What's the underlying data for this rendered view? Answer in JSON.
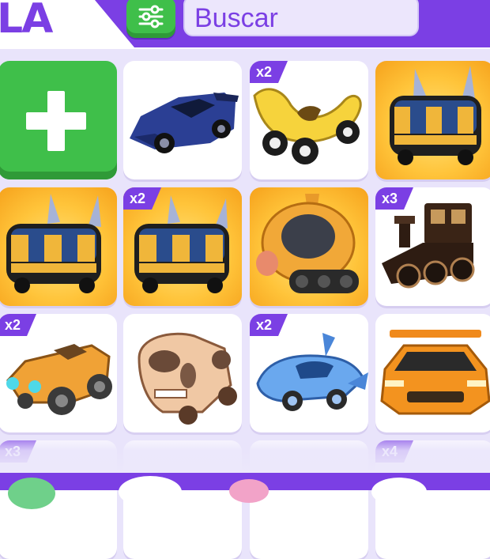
{
  "header": {
    "title_fragment": "LA",
    "search": {
      "placeholder": "Buscar"
    }
  },
  "icons": {
    "filter": "sliders-icon",
    "add": "plus-icon"
  },
  "colors": {
    "accent": "#7b3fe4",
    "add_button": "#3fbf4a",
    "tile": "#ffffff",
    "gold_tile": "#ffc43a"
  },
  "grid": {
    "rows": [
      [
        {
          "type": "add"
        },
        {
          "item": "blue-sports-car",
          "badge": ""
        },
        {
          "item": "banana-car",
          "badge": "x2"
        },
        {
          "item": "bee-bus",
          "badge": ""
        }
      ],
      [
        {
          "item": "bee-bus",
          "badge": ""
        },
        {
          "item": "bee-bus",
          "badge": "x2"
        },
        {
          "item": "dog-snow-vehicle",
          "badge": ""
        },
        {
          "item": "steam-train",
          "badge": "x3"
        }
      ],
      [
        {
          "item": "vintage-roadster",
          "badge": "x2"
        },
        {
          "item": "skull-buggy",
          "badge": ""
        },
        {
          "item": "dolphin-car",
          "badge": "x2"
        },
        {
          "item": "orange-supercar",
          "badge": ""
        }
      ],
      [
        {
          "item": "",
          "badge": "x3"
        },
        {
          "item": "",
          "badge": ""
        },
        {
          "item": "",
          "badge": ""
        },
        {
          "item": "",
          "badge": "x4"
        }
      ]
    ]
  }
}
